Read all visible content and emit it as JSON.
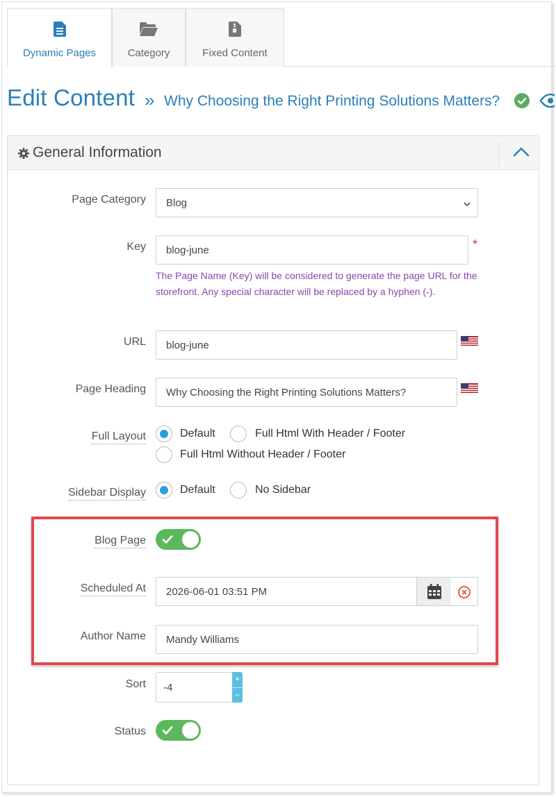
{
  "tabs": [
    {
      "label": "Dynamic Pages",
      "icon": "document-icon",
      "active": true
    },
    {
      "label": "Category",
      "icon": "folder-open-icon",
      "active": false
    },
    {
      "label": "Fixed Content",
      "icon": "file-archive-icon",
      "active": false
    }
  ],
  "header": {
    "title": "Edit Content",
    "separator": "»",
    "subtitle": "Why Choosing the Right Printing Solutions Matters?"
  },
  "panel": {
    "title": "General Information"
  },
  "form": {
    "page_category": {
      "label": "Page Category",
      "value": "Blog"
    },
    "key": {
      "label": "Key",
      "value": "blog-june",
      "required_mark": "*",
      "help": "The Page Name (Key) will be considered to generate the page URL for the storefront. Any special character will be replaced by a hyphen (-)."
    },
    "url": {
      "label": "URL",
      "value": "blog-june"
    },
    "page_heading": {
      "label": "Page Heading",
      "value": "Why Choosing the Right Printing Solutions Matters?"
    },
    "full_layout": {
      "label": "Full Layout",
      "options": [
        "Default",
        "Full Html With Header / Footer",
        "Full Html Without Header / Footer"
      ],
      "selected": "Default"
    },
    "sidebar_display": {
      "label": "Sidebar Display",
      "options": [
        "Default",
        "No Sidebar"
      ],
      "selected": "Default"
    },
    "blog_page": {
      "label": "Blog Page",
      "on": true
    },
    "scheduled_at": {
      "label": "Scheduled At",
      "value": "2026-06-01 03:51 PM"
    },
    "author_name": {
      "label": "Author Name",
      "value": "Mandy Williams"
    },
    "sort": {
      "label": "Sort",
      "value": "-4",
      "up": "+",
      "down": "−"
    },
    "status": {
      "label": "Status",
      "on": true
    }
  },
  "colors": {
    "accent": "#2b7fb8",
    "toggle_on": "#5cb85c",
    "radio_on": "#2d9fd8",
    "help_text": "#8e44ad",
    "highlight": "#e0484e",
    "spinner": "#5bc0de"
  }
}
